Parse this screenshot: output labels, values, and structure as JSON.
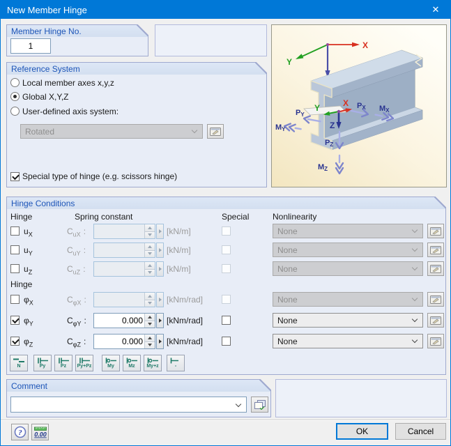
{
  "window": {
    "title": "New Member Hinge",
    "close_glyph": "✕"
  },
  "punct": {
    "colon": ":"
  },
  "member_hinge_no": {
    "label": "Member Hinge No.",
    "value": "1"
  },
  "reference_system": {
    "label": "Reference System",
    "options": [
      {
        "label": "Local member axes x,y,z",
        "selected": false
      },
      {
        "label": "Global X,Y,Z",
        "selected": true
      },
      {
        "label": "User-defined axis system:",
        "selected": false
      }
    ],
    "axis_dropdown": {
      "value": "Rotated",
      "enabled": false
    },
    "special_hinge": {
      "label": "Special type of hinge (e.g. scissors hinge)",
      "checked": true
    }
  },
  "hinge_conditions": {
    "label": "Hinge Conditions",
    "columns": {
      "hinge": "Hinge",
      "spring": "Spring constant",
      "special": "Special",
      "nonlinearity": "Nonlinearity"
    },
    "subheader": "Hinge",
    "rows": [
      {
        "label_base": "u",
        "label_sub": "X",
        "c_base": "C",
        "c_sub": "uX",
        "value": "",
        "unit": "[kN/m]",
        "nonlinearity": "None",
        "checked": false,
        "enabled": false
      },
      {
        "label_base": "u",
        "label_sub": "Y",
        "c_base": "C",
        "c_sub": "uY",
        "value": "",
        "unit": "[kN/m]",
        "nonlinearity": "None",
        "checked": false,
        "enabled": false
      },
      {
        "label_base": "u",
        "label_sub": "Z",
        "c_base": "C",
        "c_sub": "uZ",
        "value": "",
        "unit": "[kN/m]",
        "nonlinearity": "None",
        "checked": false,
        "enabled": false
      },
      {
        "label_base": "φ",
        "label_sub": "X",
        "c_base": "C",
        "c_sub": "φX",
        "value": "",
        "unit": "[kNm/rad]",
        "nonlinearity": "None",
        "checked": false,
        "enabled": false
      },
      {
        "label_base": "φ",
        "label_sub": "Y",
        "c_base": "C",
        "c_sub": "φY",
        "value": "0.000",
        "unit": "[kNm/rad]",
        "nonlinearity": "None",
        "checked": true,
        "enabled": true
      },
      {
        "label_base": "φ",
        "label_sub": "Z",
        "c_base": "C",
        "c_sub": "φZ",
        "value": "0.000",
        "unit": "[kNm/rad]",
        "nonlinearity": "None",
        "checked": true,
        "enabled": true
      }
    ]
  },
  "toolbar": {
    "buttons": [
      {
        "label": "N"
      },
      {
        "label": "Py"
      },
      {
        "label": "Pz"
      },
      {
        "label": "Py+Pz"
      },
      {
        "label": "My"
      },
      {
        "label": "Mz"
      },
      {
        "label": "My+z"
      },
      {
        "label": "-"
      }
    ]
  },
  "comment": {
    "label": "Comment",
    "value": ""
  },
  "footer": {
    "ok": "OK",
    "cancel": "Cancel",
    "units_button": "0.00",
    "help_glyph": "?"
  },
  "diagram": {
    "global_axes": {
      "x": "X",
      "y": "Y",
      "z": "Z"
    },
    "local_axes": {
      "x": "X",
      "y": "Y",
      "z": "Z"
    },
    "dof_labels": {
      "px": {
        "base": "P",
        "sub": "X"
      },
      "mx": {
        "base": "M",
        "sub": "X"
      },
      "py": {
        "base": "P",
        "sub": "Y"
      },
      "my": {
        "base": "M",
        "sub": "Y"
      },
      "pz": {
        "base": "P",
        "sub": "Z"
      },
      "mz": {
        "base": "M",
        "sub": "Z"
      }
    }
  },
  "colors": {
    "accent": "#0078d7",
    "axis_x": "#d83020",
    "axis_y": "#22a022",
    "axis_z": "#3c3f9c",
    "icon_teal": "#1f7a68",
    "arrow": "#7d85cc"
  }
}
